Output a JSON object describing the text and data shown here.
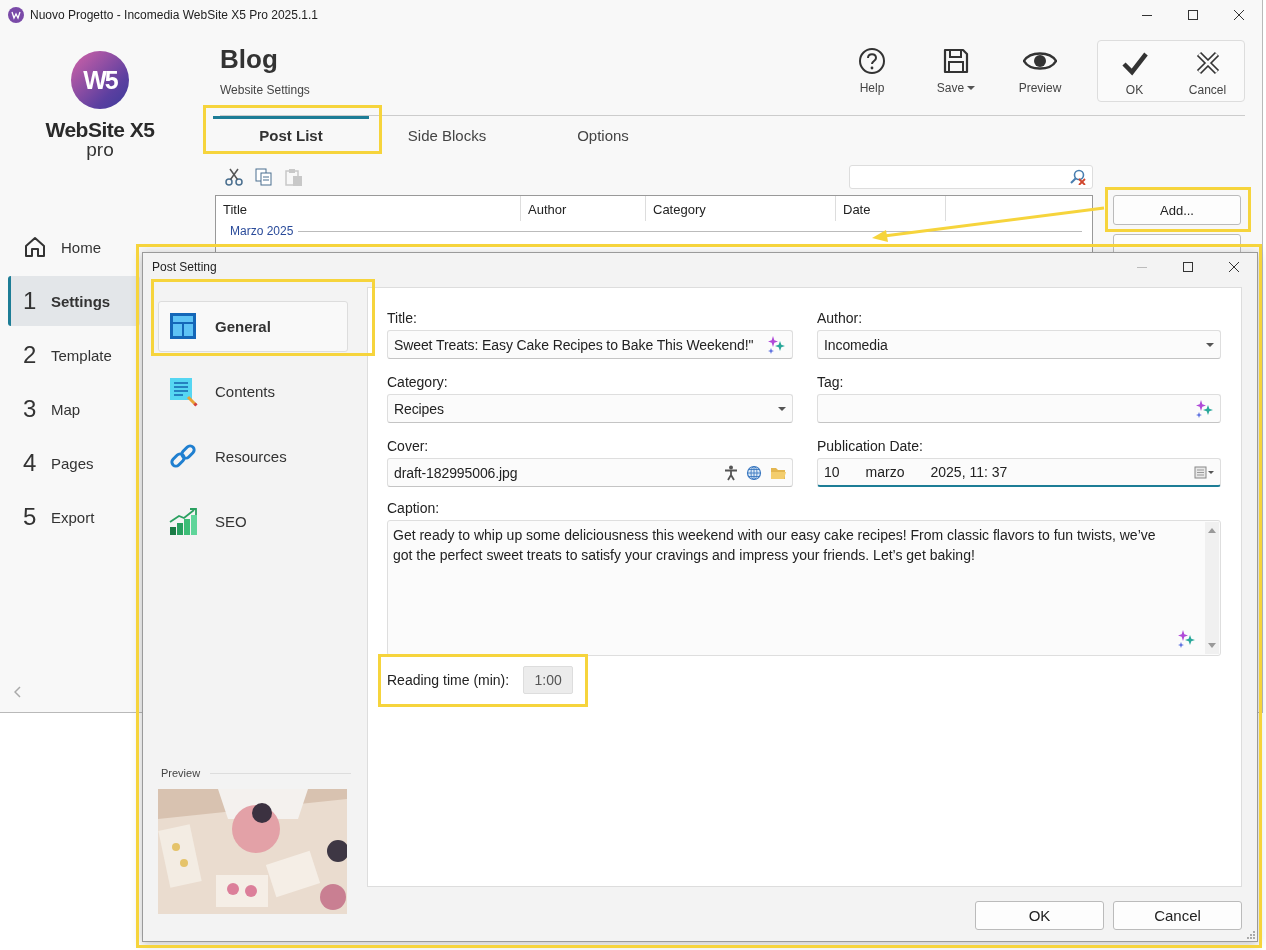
{
  "window": {
    "title": "Nuovo Progetto - Incomedia WebSite X5 Pro 2025.1.1"
  },
  "logo": {
    "mark": "W5",
    "name": "WebSite X5",
    "edition": "pro"
  },
  "header": {
    "title": "Blog",
    "subtitle": "Website Settings"
  },
  "toolbar": [
    {
      "kind": "help",
      "label": "Help"
    },
    {
      "kind": "save",
      "label": "Save",
      "dropdown": true
    },
    {
      "kind": "preview",
      "label": "Preview"
    }
  ],
  "confirm": [
    {
      "kind": "ok",
      "label": "OK"
    },
    {
      "kind": "cancel",
      "label": "Cancel"
    }
  ],
  "sidebar": {
    "items": [
      {
        "kind": "home",
        "label": "Home",
        "selected": false
      },
      {
        "kind": "step",
        "number": "1",
        "label": "Settings",
        "selected": true
      },
      {
        "kind": "step",
        "number": "2",
        "label": "Template",
        "selected": false
      },
      {
        "kind": "step",
        "number": "3",
        "label": "Map",
        "selected": false
      },
      {
        "kind": "step",
        "number": "4",
        "label": "Pages",
        "selected": false
      },
      {
        "kind": "step",
        "number": "5",
        "label": "Export",
        "selected": false
      }
    ]
  },
  "tabs": [
    {
      "label": "Post List",
      "selected": true,
      "highlighted": true
    },
    {
      "label": "Side Blocks",
      "selected": false,
      "highlighted": false
    },
    {
      "label": "Options",
      "selected": false,
      "highlighted": false
    }
  ],
  "edit_tools": [
    {
      "kind": "cut",
      "disabled": false
    },
    {
      "kind": "copy",
      "disabled": false
    },
    {
      "kind": "paste",
      "disabled": true
    }
  ],
  "post_list": {
    "columns": [
      "Title",
      "Author",
      "Category",
      "Date"
    ],
    "groups": [
      {
        "label": "Marzo 2025"
      }
    ]
  },
  "list_buttons": [
    {
      "label": "Add...",
      "highlighted": true
    },
    {
      "highlighted": false
    }
  ],
  "callout_arrow": true,
  "dialog": {
    "title": "Post Setting",
    "highlighted": true,
    "nav": [
      {
        "kind": "general",
        "label": "General",
        "selected": true,
        "highlighted": true
      },
      {
        "kind": "contents",
        "label": "Contents",
        "selected": false,
        "highlighted": false
      },
      {
        "kind": "resources",
        "label": "Resources",
        "selected": false,
        "highlighted": false
      },
      {
        "kind": "seo",
        "label": "SEO",
        "selected": false,
        "highlighted": false
      }
    ],
    "preview": {
      "label": "Preview"
    },
    "fields": [
      {
        "kind": "text",
        "label": "Title:",
        "value": "Sweet Treats: Easy Cake Recipes to Bake This Weekend!\"",
        "ai": true
      },
      {
        "kind": "select",
        "label": "Author:",
        "value": "Incomedia"
      },
      {
        "kind": "select",
        "label": "Category:",
        "value": "Recipes"
      },
      {
        "kind": "text",
        "label": "Tag:",
        "ai": true
      },
      {
        "kind": "file",
        "label": "Cover:",
        "value": "draft-182995006.jpg"
      },
      {
        "kind": "date",
        "label": "Publication Date:",
        "parts": [
          "10",
          "marzo",
          "2025, 11: 37"
        ],
        "focused": true
      }
    ],
    "caption": {
      "label": "Caption:",
      "value": "Get ready to whip up some deliciousness this weekend with our easy cake recipes! From classic flavors to fun twists, we’ve got the perfect sweet treats to satisfy your cravings and impress your friends. Let’s get baking!",
      "ai": true
    },
    "reading_time": {
      "label": "Reading time (min):",
      "value": "1:00",
      "disabled": true,
      "highlighted": true
    },
    "buttons": [
      {
        "label": "OK"
      },
      {
        "label": "Cancel"
      }
    ]
  }
}
